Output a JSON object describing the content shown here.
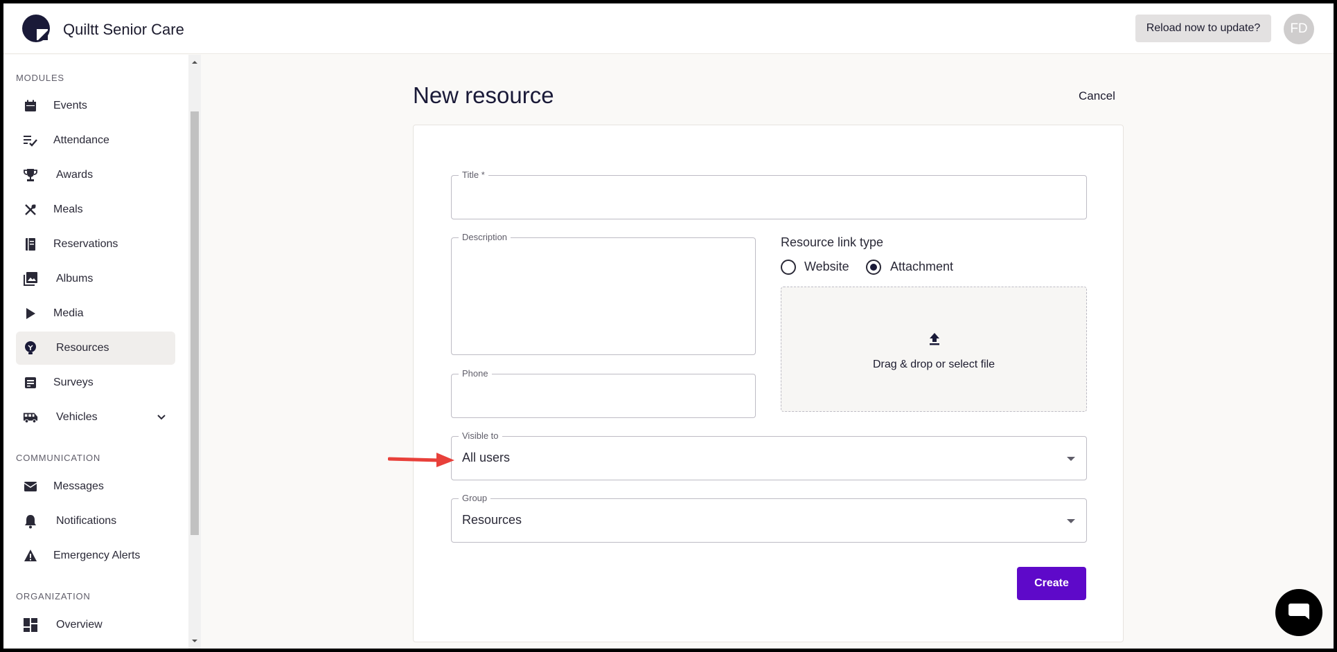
{
  "header": {
    "app_title": "Quiltt Senior Care",
    "reload_label": "Reload now to update?",
    "avatar_initials": "FD"
  },
  "sidebar": {
    "sections": [
      {
        "label": "MODULES"
      },
      {
        "label": "COMMUNICATION"
      },
      {
        "label": "ORGANIZATION"
      }
    ],
    "items": [
      {
        "label": "Events",
        "icon": "calendar-icon"
      },
      {
        "label": "Attendance",
        "icon": "checklist-icon"
      },
      {
        "label": "Awards",
        "icon": "trophy-icon"
      },
      {
        "label": "Meals",
        "icon": "utensils-icon"
      },
      {
        "label": "Reservations",
        "icon": "book-icon"
      },
      {
        "label": "Albums",
        "icon": "photo-library-icon"
      },
      {
        "label": "Media",
        "icon": "play-icon"
      },
      {
        "label": "Resources",
        "icon": "lightbulb-icon",
        "active": true
      },
      {
        "label": "Surveys",
        "icon": "survey-icon"
      },
      {
        "label": "Vehicles",
        "icon": "bus-icon",
        "expandable": true
      },
      {
        "label": "Messages",
        "icon": "mail-icon"
      },
      {
        "label": "Notifications",
        "icon": "bell-icon"
      },
      {
        "label": "Emergency Alerts",
        "icon": "warning-icon"
      },
      {
        "label": "Overview",
        "icon": "dashboard-icon"
      }
    ]
  },
  "main": {
    "page_title": "New resource",
    "cancel_label": "Cancel",
    "form": {
      "title_label": "Title *",
      "title_value": "",
      "description_label": "Description",
      "description_value": "",
      "phone_label": "Phone",
      "phone_value": "",
      "link_type_label": "Resource link type",
      "link_type_options": [
        {
          "label": "Website",
          "checked": false
        },
        {
          "label": "Attachment",
          "checked": true
        }
      ],
      "dropzone_text": "Drag & drop or select file",
      "visible_to_label": "Visible to",
      "visible_to_value": "All users",
      "group_label": "Group",
      "group_value": "Resources",
      "create_label": "Create"
    }
  },
  "colors": {
    "primary_button": "#5e09c9",
    "title_text": "#1a1a38",
    "annotation_arrow": "#e8403a"
  }
}
